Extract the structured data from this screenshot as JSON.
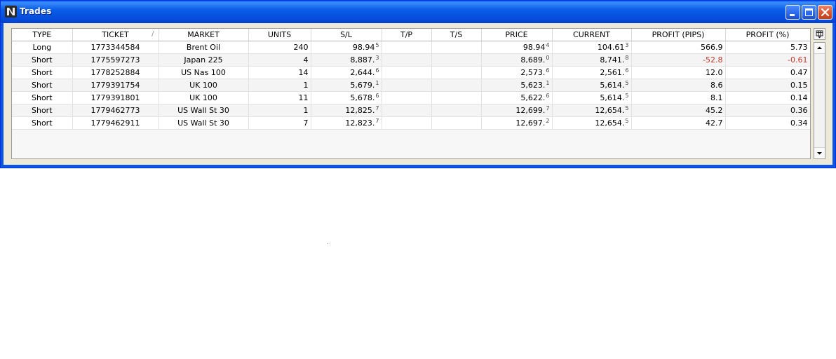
{
  "window": {
    "title": "Trades",
    "icon": "ninja-app-icon"
  },
  "table": {
    "columns": [
      "TYPE",
      "TICKET",
      "MARKET",
      "UNITS",
      "S/L",
      "T/P",
      "T/S",
      "PRICE",
      "CURRENT",
      "PROFIT (PIPS)",
      "PROFIT (%)"
    ],
    "sort_indicator": "/",
    "rows": [
      {
        "type": "Long",
        "ticket": "1773344584",
        "market": "Brent Oil",
        "units": "240",
        "sl_main": "98.94",
        "sl_frac": "5",
        "tp": "",
        "ts": "",
        "price_main": "98.94",
        "price_frac": "4",
        "current_main": "104.61",
        "current_frac": "3",
        "pips": "566.9",
        "pct": "5.73",
        "negative": false
      },
      {
        "type": "Short",
        "ticket": "1775597273",
        "market": "Japan 225",
        "units": "4",
        "sl_main": "8,887.",
        "sl_frac": "3",
        "tp": "",
        "ts": "",
        "price_main": "8,689.",
        "price_frac": "0",
        "current_main": "8,741.",
        "current_frac": "8",
        "pips": "-52.8",
        "pct": "-0.61",
        "negative": true
      },
      {
        "type": "Short",
        "ticket": "1778252884",
        "market": "US Nas 100",
        "units": "14",
        "sl_main": "2,644.",
        "sl_frac": "6",
        "tp": "",
        "ts": "",
        "price_main": "2,573.",
        "price_frac": "6",
        "current_main": "2,561.",
        "current_frac": "6",
        "pips": "12.0",
        "pct": "0.47",
        "negative": false
      },
      {
        "type": "Short",
        "ticket": "1779391754",
        "market": "UK 100",
        "units": "1",
        "sl_main": "5,679.",
        "sl_frac": "1",
        "tp": "",
        "ts": "",
        "price_main": "5,623.",
        "price_frac": "1",
        "current_main": "5,614.",
        "current_frac": "5",
        "pips": "8.6",
        "pct": "0.15",
        "negative": false
      },
      {
        "type": "Short",
        "ticket": "1779391801",
        "market": "UK 100",
        "units": "11",
        "sl_main": "5,678.",
        "sl_frac": "6",
        "tp": "",
        "ts": "",
        "price_main": "5,622.",
        "price_frac": "6",
        "current_main": "5,614.",
        "current_frac": "5",
        "pips": "8.1",
        "pct": "0.14",
        "negative": false
      },
      {
        "type": "Short",
        "ticket": "1779462773",
        "market": "US Wall St 30",
        "units": "1",
        "sl_main": "12,825.",
        "sl_frac": "7",
        "tp": "",
        "ts": "",
        "price_main": "12,699.",
        "price_frac": "7",
        "current_main": "12,654.",
        "current_frac": "5",
        "pips": "45.2",
        "pct": "0.36",
        "negative": false
      },
      {
        "type": "Short",
        "ticket": "1779462911",
        "market": "US Wall St 30",
        "units": "7",
        "sl_main": "12,823.",
        "sl_frac": "7",
        "tp": "",
        "ts": "",
        "price_main": "12,697.",
        "price_frac": "2",
        "current_main": "12,654.",
        "current_frac": "5",
        "pips": "42.7",
        "pct": "0.34",
        "negative": false
      }
    ]
  },
  "colors": {
    "title_bar": "#0b55e3",
    "negative": "#c0392b",
    "close_button": "#d9532f"
  },
  "icons": {
    "minimize": "minimize-icon",
    "maximize": "maximize-icon",
    "close": "close-icon",
    "column_chooser": "column-chooser-icon",
    "scroll_up": "scroll-up-arrow-icon",
    "scroll_down": "scroll-down-arrow-icon"
  }
}
